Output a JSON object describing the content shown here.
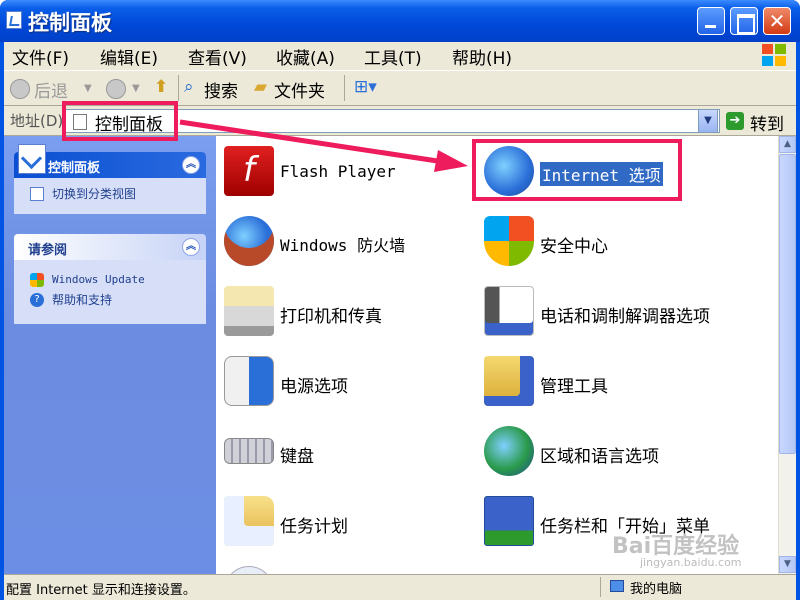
{
  "window": {
    "title": "控制面板",
    "controls": {
      "minimize": "",
      "maximize": "",
      "close": "✕"
    }
  },
  "menu": [
    {
      "label": "文件(F)"
    },
    {
      "label": "编辑(E)"
    },
    {
      "label": "查看(V)"
    },
    {
      "label": "收藏(A)"
    },
    {
      "label": "工具(T)"
    },
    {
      "label": "帮助(H)"
    }
  ],
  "toolbar": {
    "back_label": "后退",
    "search_label": "搜索",
    "folders_label": "文件夹",
    "views_icon": "views-grid-icon"
  },
  "address": {
    "label": "地址(D)",
    "value": "控制面板",
    "go_label": "转到"
  },
  "sidebar": {
    "panels": [
      {
        "title": "控制面板",
        "links": [
          {
            "label": "切换到分类视图",
            "icon": "switch-view-icon"
          }
        ]
      },
      {
        "title": "请参阅",
        "links": [
          {
            "label": "Windows Update",
            "icon": "windows-update-icon"
          },
          {
            "label": "帮助和支持",
            "icon": "help-icon"
          }
        ]
      }
    ]
  },
  "items": [
    {
      "label": "Flash Player",
      "icon": "flash-icon"
    },
    {
      "label": "Internet 选项",
      "icon": "internet-options-icon",
      "selected": true
    },
    {
      "label": "Windows 防火墙",
      "icon": "firewall-icon"
    },
    {
      "label": "安全中心",
      "icon": "security-shield-icon"
    },
    {
      "label": "打印机和传真",
      "icon": "printer-icon"
    },
    {
      "label": "电话和调制解调器选项",
      "icon": "phone-modem-icon"
    },
    {
      "label": "电源选项",
      "icon": "power-icon"
    },
    {
      "label": "管理工具",
      "icon": "admin-tools-icon"
    },
    {
      "label": "键盘",
      "icon": "keyboard-icon"
    },
    {
      "label": "区域和语言选项",
      "icon": "globe-icon"
    },
    {
      "label": "任务计划",
      "icon": "task-folder-icon"
    },
    {
      "label": "任务栏和「开始」菜单",
      "icon": "taskbar-icon"
    }
  ],
  "status": {
    "text": "配置 Internet 显示和连接设置。",
    "zone": "我的电脑"
  },
  "watermark": {
    "brand": "Bai百度经验",
    "url": "jingyan.baidu.com"
  },
  "colors": {
    "titlebar": "#0048d8",
    "sidebar": "#6b8ce0",
    "highlight": "#ee1c5c",
    "selection": "#316ac5"
  }
}
